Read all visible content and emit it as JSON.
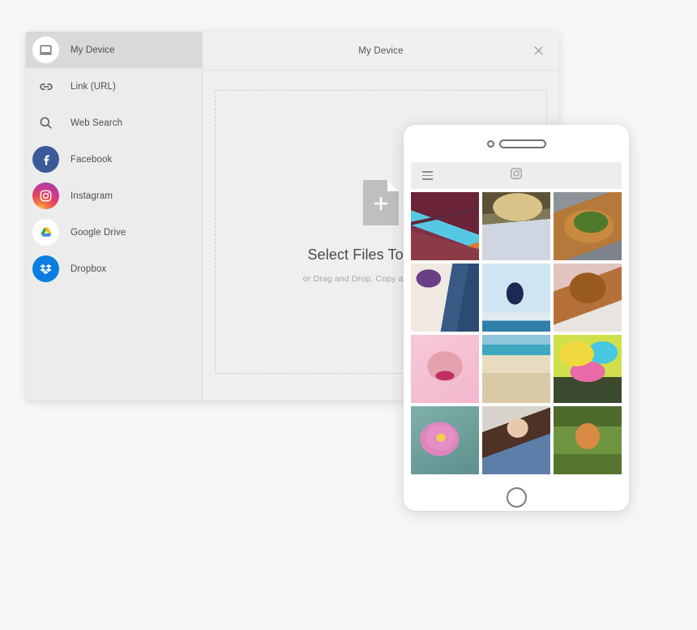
{
  "dialog": {
    "header_title": "My Device",
    "close_icon": "close-icon",
    "dropzone": {
      "file_icon": "file-add-icon",
      "title": "Select Files To Upload",
      "subtitle": "or Drag and Drop, Copy and Paste Files"
    }
  },
  "sidebar": {
    "items": [
      {
        "label": "My Device",
        "icon": "laptop-icon",
        "selected": true
      },
      {
        "label": "Link (URL)",
        "icon": "link-icon",
        "selected": false
      },
      {
        "label": "Web Search",
        "icon": "search-icon",
        "selected": false
      },
      {
        "label": "Facebook",
        "icon": "facebook-icon",
        "selected": false
      },
      {
        "label": "Instagram",
        "icon": "instagram-icon",
        "selected": false
      },
      {
        "label": "Google Drive",
        "icon": "google-drive-icon",
        "selected": false
      },
      {
        "label": "Dropbox",
        "icon": "dropbox-icon",
        "selected": false
      }
    ]
  },
  "tablet": {
    "camera_icon": "camera-dot-icon",
    "speaker_icon": "speaker-slot-icon",
    "appbar": {
      "menu_icon": "hamburger-menu-icon",
      "app_icon": "instagram-camera-icon"
    },
    "home_button_icon": "home-circle-icon",
    "photos": [
      {
        "name": "canyon-landscape-photo",
        "art": "canyon"
      },
      {
        "name": "hands-portrait-photo",
        "art": "hands"
      },
      {
        "name": "pizza-food-photo",
        "art": "pizza"
      },
      {
        "name": "bride-wedding-photo",
        "art": "bride"
      },
      {
        "name": "skateboarder-jump-photo",
        "art": "skate"
      },
      {
        "name": "dog-in-bucket-photo",
        "art": "dog"
      },
      {
        "name": "pink-lips-photo",
        "art": "lips"
      },
      {
        "name": "beach-cove-photo",
        "art": "beach"
      },
      {
        "name": "holi-festival-photo",
        "art": "holi"
      },
      {
        "name": "pink-cosmos-flower-photo",
        "art": "flower"
      },
      {
        "name": "woman-portrait-photo",
        "art": "woman"
      },
      {
        "name": "red-fox-photo",
        "art": "fox"
      }
    ]
  },
  "colors": {
    "facebook": "#3b5a9a",
    "dropbox": "#0a7ee0",
    "selected_row": "#d9d9d9",
    "page_background": "#f7f7f8"
  }
}
